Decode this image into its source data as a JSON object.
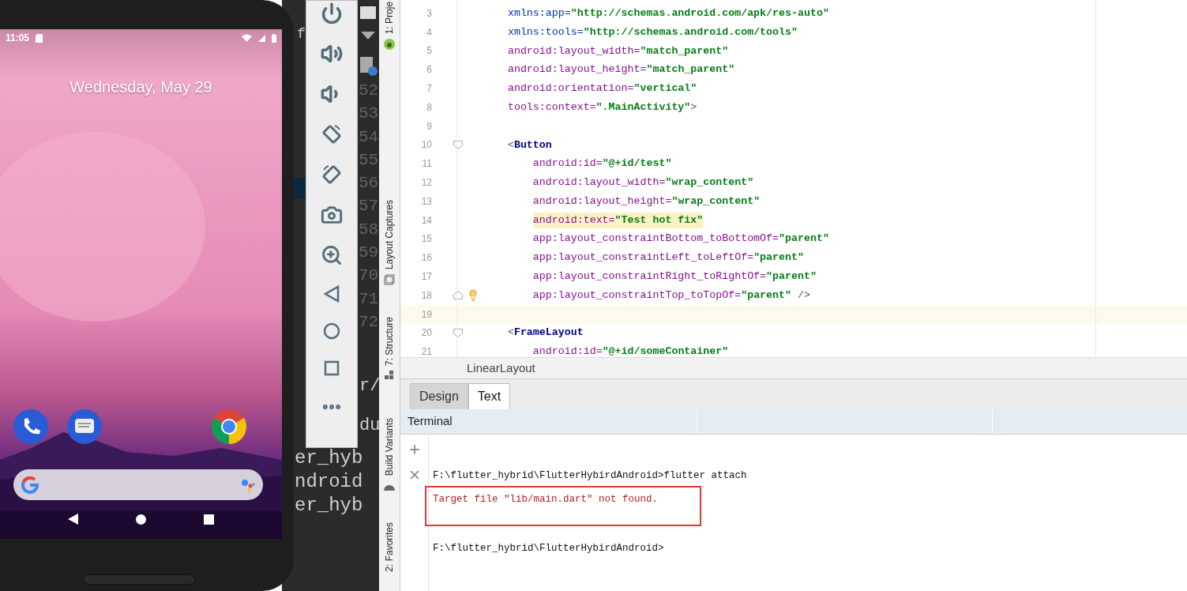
{
  "phone": {
    "time": "11:05",
    "date": "Wednesday, May 29"
  },
  "background_window": {
    "line_numbers": [
      "52",
      "53",
      "54",
      "55",
      "56",
      "57",
      "58",
      "59",
      "70",
      "71",
      "72"
    ],
    "fragments": [
      "f",
      "r/",
      "du",
      "er_hyb",
      "ndroid",
      "er_hyb"
    ]
  },
  "tool_strip": {
    "items": [
      "1: Proje",
      "Layout Captures",
      "7: Structure",
      "Build Variants",
      "2: Favorites"
    ]
  },
  "editor": {
    "lines": [
      {
        "number": "3",
        "current": false,
        "highlighted": false,
        "fold_start": false,
        "fold_end": false,
        "bulb": false,
        "segments": [
          {
            "kind": "ns",
            "text": "    xmlns:app="
          },
          {
            "kind": "value",
            "text": "\"http://schemas.android.com/apk/res-auto\""
          }
        ]
      },
      {
        "number": "4",
        "current": false,
        "highlighted": false,
        "fold_start": false,
        "fold_end": false,
        "bulb": false,
        "segments": [
          {
            "kind": "ns",
            "text": "    xmlns:tools="
          },
          {
            "kind": "value",
            "text": "\"http://schemas.android.com/tools\""
          }
        ]
      },
      {
        "number": "5",
        "current": false,
        "highlighted": false,
        "fold_start": false,
        "fold_end": false,
        "bulb": false,
        "segments": [
          {
            "kind": "attr",
            "text": "    android:layout_width="
          },
          {
            "kind": "value",
            "text": "\"match_parent\""
          }
        ]
      },
      {
        "number": "6",
        "current": false,
        "highlighted": false,
        "fold_start": false,
        "fold_end": false,
        "bulb": false,
        "segments": [
          {
            "kind": "attr",
            "text": "    android:layout_height="
          },
          {
            "kind": "value",
            "text": "\"match_parent\""
          }
        ]
      },
      {
        "number": "7",
        "current": false,
        "highlighted": false,
        "fold_start": false,
        "fold_end": false,
        "bulb": false,
        "segments": [
          {
            "kind": "attr",
            "text": "    android:orientation="
          },
          {
            "kind": "value",
            "text": "\"vertical\""
          }
        ]
      },
      {
        "number": "8",
        "current": false,
        "highlighted": false,
        "fold_start": false,
        "fold_end": false,
        "bulb": false,
        "segments": [
          {
            "kind": "attr",
            "text": "    tools:context="
          },
          {
            "kind": "value",
            "text": "\".MainActivity\""
          },
          {
            "kind": "punct",
            "text": ">"
          }
        ]
      },
      {
        "number": "9",
        "current": false,
        "highlighted": false,
        "fold_start": false,
        "fold_end": false,
        "bulb": false
      },
      {
        "number": "10",
        "current": false,
        "highlighted": false,
        "fold_start": true,
        "fold_end": false,
        "bulb": false,
        "segments": [
          {
            "kind": "punct",
            "text": "    <"
          },
          {
            "kind": "tag",
            "text": "Button"
          }
        ]
      },
      {
        "number": "11",
        "current": false,
        "highlighted": false,
        "fold_start": false,
        "fold_end": false,
        "bulb": false,
        "segments": [
          {
            "kind": "attr",
            "text": "        android:id="
          },
          {
            "kind": "value",
            "text": "\"@+id/test\""
          }
        ]
      },
      {
        "number": "12",
        "current": false,
        "highlighted": false,
        "fold_start": false,
        "fold_end": false,
        "bulb": false,
        "segments": [
          {
            "kind": "attr",
            "text": "        android:layout_width="
          },
          {
            "kind": "value",
            "text": "\"wrap_content\""
          }
        ]
      },
      {
        "number": "13",
        "current": false,
        "highlighted": false,
        "fold_start": false,
        "fold_end": false,
        "bulb": false,
        "segments": [
          {
            "kind": "attr",
            "text": "        android:layout_height="
          },
          {
            "kind": "value",
            "text": "\"wrap_content\""
          }
        ]
      },
      {
        "number": "14",
        "current": false,
        "highlighted": true,
        "fold_start": false,
        "fold_end": false,
        "bulb": false,
        "segments": [
          {
            "kind": "attr",
            "text": "        android:text="
          },
          {
            "kind": "value",
            "text": "\"Test hot fix\""
          }
        ]
      },
      {
        "number": "15",
        "current": false,
        "highlighted": false,
        "fold_start": false,
        "fold_end": false,
        "bulb": false,
        "segments": [
          {
            "kind": "attr",
            "text": "        app:layout_constraintBottom_toBottomOf="
          },
          {
            "kind": "value",
            "text": "\"parent\""
          }
        ]
      },
      {
        "number": "16",
        "current": false,
        "highlighted": false,
        "fold_start": false,
        "fold_end": false,
        "bulb": false,
        "segments": [
          {
            "kind": "attr",
            "text": "        app:layout_constraintLeft_toLeftOf="
          },
          {
            "kind": "value",
            "text": "\"parent\""
          }
        ]
      },
      {
        "number": "17",
        "current": false,
        "highlighted": false,
        "fold_start": false,
        "fold_end": false,
        "bulb": false,
        "segments": [
          {
            "kind": "attr",
            "text": "        app:layout_constraintRight_toRightOf="
          },
          {
            "kind": "value",
            "text": "\"parent\""
          }
        ]
      },
      {
        "number": "18",
        "current": false,
        "highlighted": false,
        "fold_start": false,
        "fold_end": true,
        "bulb": true,
        "segments": [
          {
            "kind": "attr",
            "text": "        app:layout_constraintTop_toTopOf="
          },
          {
            "kind": "value",
            "text": "\"parent\""
          },
          {
            "kind": "punct",
            "text": " />"
          }
        ]
      },
      {
        "number": "19",
        "current": true,
        "highlighted": false,
        "fold_start": false,
        "fold_end": false,
        "bulb": false
      },
      {
        "number": "20",
        "current": false,
        "highlighted": false,
        "fold_start": true,
        "fold_end": false,
        "bulb": false,
        "segments": [
          {
            "kind": "punct",
            "text": "    <"
          },
          {
            "kind": "tag",
            "text": "FrameLayout"
          }
        ]
      },
      {
        "number": "21",
        "current": false,
        "highlighted": false,
        "fold_start": false,
        "fold_end": false,
        "bulb": false,
        "segments": [
          {
            "kind": "attr",
            "text": "        android:id="
          },
          {
            "kind": "value",
            "text": "\"@+id/someContainer\""
          }
        ]
      }
    ]
  },
  "breadcrumb": "LinearLayout",
  "tabs": [
    {
      "label": "Design",
      "selected": false
    },
    {
      "label": "Text",
      "selected": true
    }
  ],
  "terminal": {
    "title": "Terminal",
    "lines": [
      {
        "kind": "command",
        "boxed": false,
        "text": "F:\\flutter_hybrid\\FlutterHybirdAndroid>flutter attach"
      },
      {
        "kind": "error",
        "boxed": true,
        "text": "Target file \"lib/main.dart\" not found."
      },
      {
        "kind": "command",
        "boxed": false,
        "text": "F:\\flutter_hybrid\\FlutterHybirdAndroid>"
      }
    ]
  }
}
